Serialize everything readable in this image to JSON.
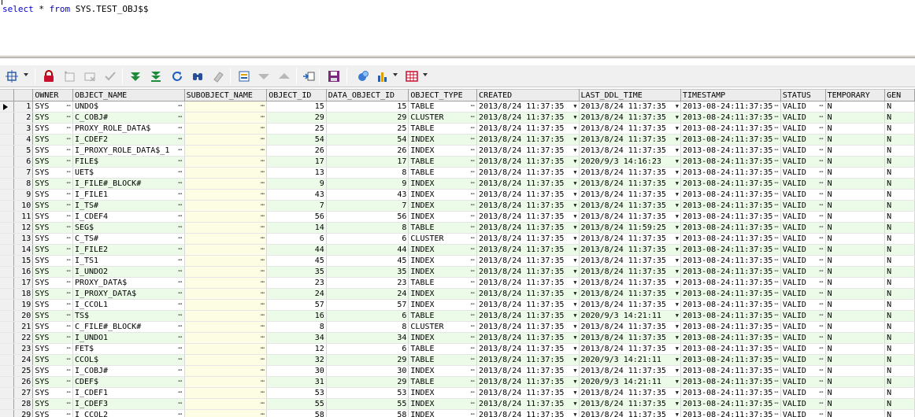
{
  "editor": {
    "sql_keyword1": "select",
    "sql_star": " * ",
    "sql_keyword2": "from",
    "sql_rest": " SYS.TEST_OBJ$$"
  },
  "colors": {
    "row_alt": "#ecfbe8",
    "subobject_col": "#fdfde4",
    "keyword": "#0000cc"
  },
  "toolbar": {
    "buttons": [
      "select-all-icon",
      "lock-icon",
      "add-record-icon",
      "delete-record-icon",
      "post-changes-icon",
      "next-page-icon",
      "last-page-icon",
      "refresh-icon",
      "find-icon",
      "clear-icon",
      "query-by-example-icon",
      "filter-icon",
      "sort-icon",
      "export-icon",
      "save-icon",
      "clipboard-icon",
      "chart-icon",
      "grid-layout-icon"
    ]
  },
  "grid": {
    "columns": [
      "OWNER",
      "OBJECT_NAME",
      "SUBOBJECT_NAME",
      "OBJECT_ID",
      "DATA_OBJECT_ID",
      "OBJECT_TYPE",
      "CREATED",
      "LAST_DDL_TIME",
      "TIMESTAMP",
      "STATUS",
      "TEMPORARY",
      "GEN"
    ],
    "rows": [
      [
        "1",
        "SYS",
        "UNDO$",
        "",
        "15",
        "15",
        "TABLE",
        "2013/8/24 11:37:35",
        "2013/8/24 11:37:35",
        "2013-08-24:11:37:35",
        "VALID",
        "N",
        "N"
      ],
      [
        "2",
        "SYS",
        "C_COBJ#",
        "",
        "29",
        "29",
        "CLUSTER",
        "2013/8/24 11:37:35",
        "2013/8/24 11:37:35",
        "2013-08-24:11:37:35",
        "VALID",
        "N",
        "N"
      ],
      [
        "3",
        "SYS",
        "PROXY_ROLE_DATA$",
        "",
        "25",
        "25",
        "TABLE",
        "2013/8/24 11:37:35",
        "2013/8/24 11:37:35",
        "2013-08-24:11:37:35",
        "VALID",
        "N",
        "N"
      ],
      [
        "4",
        "SYS",
        "I_CDEF2",
        "",
        "54",
        "54",
        "INDEX",
        "2013/8/24 11:37:35",
        "2013/8/24 11:37:35",
        "2013-08-24:11:37:35",
        "VALID",
        "N",
        "N"
      ],
      [
        "5",
        "SYS",
        "I_PROXY_ROLE_DATA$_1",
        "",
        "26",
        "26",
        "INDEX",
        "2013/8/24 11:37:35",
        "2013/8/24 11:37:35",
        "2013-08-24:11:37:35",
        "VALID",
        "N",
        "N"
      ],
      [
        "6",
        "SYS",
        "FILE$",
        "",
        "17",
        "17",
        "TABLE",
        "2013/8/24 11:37:35",
        "2020/9/3 14:16:23",
        "2013-08-24:11:37:35",
        "VALID",
        "N",
        "N"
      ],
      [
        "7",
        "SYS",
        "UET$",
        "",
        "13",
        "8",
        "TABLE",
        "2013/8/24 11:37:35",
        "2013/8/24 11:37:35",
        "2013-08-24:11:37:35",
        "VALID",
        "N",
        "N"
      ],
      [
        "8",
        "SYS",
        "I_FILE#_BLOCK#",
        "",
        "9",
        "9",
        "INDEX",
        "2013/8/24 11:37:35",
        "2013/8/24 11:37:35",
        "2013-08-24:11:37:35",
        "VALID",
        "N",
        "N"
      ],
      [
        "9",
        "SYS",
        "I_FILE1",
        "",
        "43",
        "43",
        "INDEX",
        "2013/8/24 11:37:35",
        "2013/8/24 11:37:35",
        "2013-08-24:11:37:35",
        "VALID",
        "N",
        "N"
      ],
      [
        "10",
        "SYS",
        "I_TS#",
        "",
        "7",
        "7",
        "INDEX",
        "2013/8/24 11:37:35",
        "2013/8/24 11:37:35",
        "2013-08-24:11:37:35",
        "VALID",
        "N",
        "N"
      ],
      [
        "11",
        "SYS",
        "I_CDEF4",
        "",
        "56",
        "56",
        "INDEX",
        "2013/8/24 11:37:35",
        "2013/8/24 11:37:35",
        "2013-08-24:11:37:35",
        "VALID",
        "N",
        "N"
      ],
      [
        "12",
        "SYS",
        "SEG$",
        "",
        "14",
        "8",
        "TABLE",
        "2013/8/24 11:37:35",
        "2013/8/24 11:59:25",
        "2013-08-24:11:37:35",
        "VALID",
        "N",
        "N"
      ],
      [
        "13",
        "SYS",
        "C_TS#",
        "",
        "6",
        "6",
        "CLUSTER",
        "2013/8/24 11:37:35",
        "2013/8/24 11:37:35",
        "2013-08-24:11:37:35",
        "VALID",
        "N",
        "N"
      ],
      [
        "14",
        "SYS",
        "I_FILE2",
        "",
        "44",
        "44",
        "INDEX",
        "2013/8/24 11:37:35",
        "2013/8/24 11:37:35",
        "2013-08-24:11:37:35",
        "VALID",
        "N",
        "N"
      ],
      [
        "15",
        "SYS",
        "I_TS1",
        "",
        "45",
        "45",
        "INDEX",
        "2013/8/24 11:37:35",
        "2013/8/24 11:37:35",
        "2013-08-24:11:37:35",
        "VALID",
        "N",
        "N"
      ],
      [
        "16",
        "SYS",
        "I_UNDO2",
        "",
        "35",
        "35",
        "INDEX",
        "2013/8/24 11:37:35",
        "2013/8/24 11:37:35",
        "2013-08-24:11:37:35",
        "VALID",
        "N",
        "N"
      ],
      [
        "17",
        "SYS",
        "PROXY_DATA$",
        "",
        "23",
        "23",
        "TABLE",
        "2013/8/24 11:37:35",
        "2013/8/24 11:37:35",
        "2013-08-24:11:37:35",
        "VALID",
        "N",
        "N"
      ],
      [
        "18",
        "SYS",
        "I_PROXY_DATA$",
        "",
        "24",
        "24",
        "INDEX",
        "2013/8/24 11:37:35",
        "2013/8/24 11:37:35",
        "2013-08-24:11:37:35",
        "VALID",
        "N",
        "N"
      ],
      [
        "19",
        "SYS",
        "I_CCOL1",
        "",
        "57",
        "57",
        "INDEX",
        "2013/8/24 11:37:35",
        "2013/8/24 11:37:35",
        "2013-08-24:11:37:35",
        "VALID",
        "N",
        "N"
      ],
      [
        "20",
        "SYS",
        "TS$",
        "",
        "16",
        "6",
        "TABLE",
        "2013/8/24 11:37:35",
        "2020/9/3 14:21:11",
        "2013-08-24:11:37:35",
        "VALID",
        "N",
        "N"
      ],
      [
        "21",
        "SYS",
        "C_FILE#_BLOCK#",
        "",
        "8",
        "8",
        "CLUSTER",
        "2013/8/24 11:37:35",
        "2013/8/24 11:37:35",
        "2013-08-24:11:37:35",
        "VALID",
        "N",
        "N"
      ],
      [
        "22",
        "SYS",
        "I_UNDO1",
        "",
        "34",
        "34",
        "INDEX",
        "2013/8/24 11:37:35",
        "2013/8/24 11:37:35",
        "2013-08-24:11:37:35",
        "VALID",
        "N",
        "N"
      ],
      [
        "23",
        "SYS",
        "FET$",
        "",
        "12",
        "6",
        "TABLE",
        "2013/8/24 11:37:35",
        "2013/8/24 11:37:35",
        "2013-08-24:11:37:35",
        "VALID",
        "N",
        "N"
      ],
      [
        "24",
        "SYS",
        "CCOL$",
        "",
        "32",
        "29",
        "TABLE",
        "2013/8/24 11:37:35",
        "2020/9/3 14:21:11",
        "2013-08-24:11:37:35",
        "VALID",
        "N",
        "N"
      ],
      [
        "25",
        "SYS",
        "I_COBJ#",
        "",
        "30",
        "30",
        "INDEX",
        "2013/8/24 11:37:35",
        "2013/8/24 11:37:35",
        "2013-08-24:11:37:35",
        "VALID",
        "N",
        "N"
      ],
      [
        "26",
        "SYS",
        "CDEF$",
        "",
        "31",
        "29",
        "TABLE",
        "2013/8/24 11:37:35",
        "2020/9/3 14:21:11",
        "2013-08-24:11:37:35",
        "VALID",
        "N",
        "N"
      ],
      [
        "27",
        "SYS",
        "I_CDEF1",
        "",
        "53",
        "53",
        "INDEX",
        "2013/8/24 11:37:35",
        "2013/8/24 11:37:35",
        "2013-08-24:11:37:35",
        "VALID",
        "N",
        "N"
      ],
      [
        "28",
        "SYS",
        "I_CDEF3",
        "",
        "55",
        "55",
        "INDEX",
        "2013/8/24 11:37:35",
        "2013/8/24 11:37:35",
        "2013-08-24:11:37:35",
        "VALID",
        "N",
        "N"
      ],
      [
        "29",
        "SYS",
        "I_CCOL2",
        "",
        "58",
        "58",
        "INDEX",
        "2013/8/24 11:37:35",
        "2013/8/24 11:37:35",
        "2013-08-24:11:37:35",
        "VALID",
        "N",
        "N"
      ]
    ]
  }
}
